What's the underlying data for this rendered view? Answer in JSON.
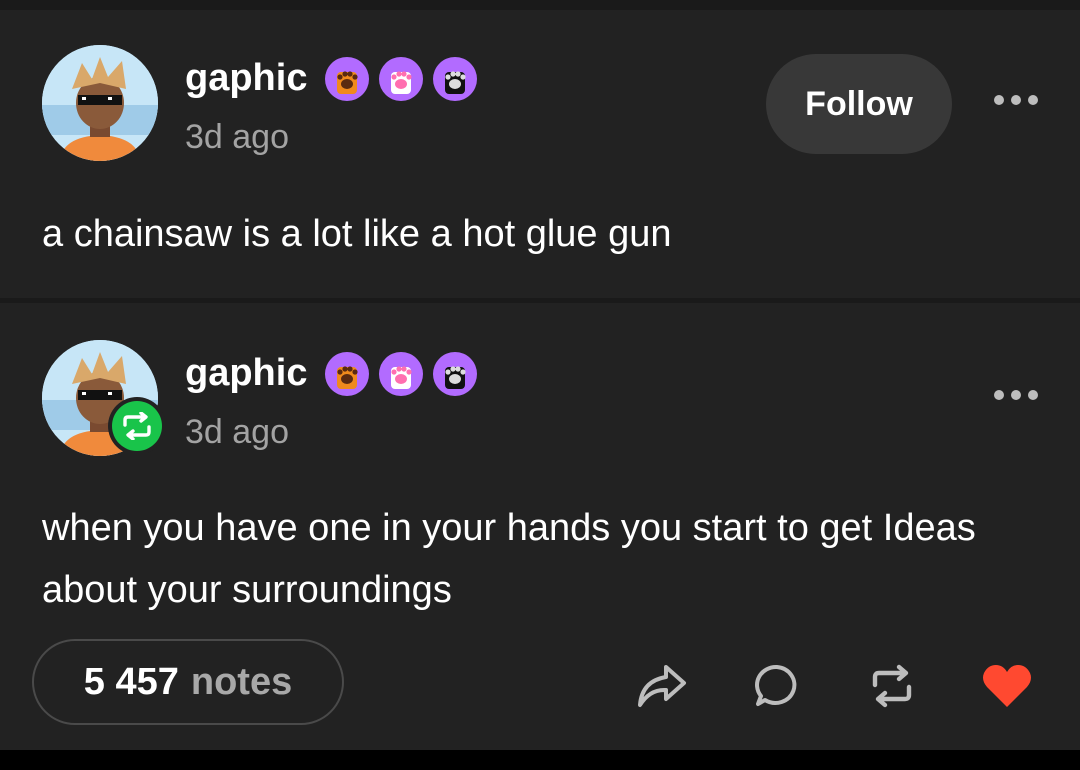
{
  "posts": [
    {
      "username": "gaphic",
      "timestamp": "3d ago",
      "follow_label": "Follow",
      "body": "a chainsaw is a lot like a hot glue gun",
      "badge_icons": [
        "orange-paw-badge-icon",
        "pink-paw-badge-icon",
        "black-paw-badge-icon"
      ]
    },
    {
      "username": "gaphic",
      "timestamp": "3d ago",
      "body": "when you have one in your hands you start to get Ideas about your surroundings",
      "badge_icons": [
        "orange-paw-badge-icon",
        "pink-paw-badge-icon",
        "black-paw-badge-icon"
      ],
      "reblog_badge": "reblog-icon"
    }
  ],
  "footer": {
    "notes_count": "5 457",
    "notes_label": "notes",
    "actions": [
      "share-icon",
      "reply-icon",
      "reblog-icon",
      "heart-icon"
    ]
  },
  "colors": {
    "background": "#222222",
    "follow_button": "#383838",
    "reblog_green": "#19c44a",
    "heart_red": "#ff4930",
    "badge_purple": "#b26bff",
    "muted_text": "#a3a3a3"
  }
}
